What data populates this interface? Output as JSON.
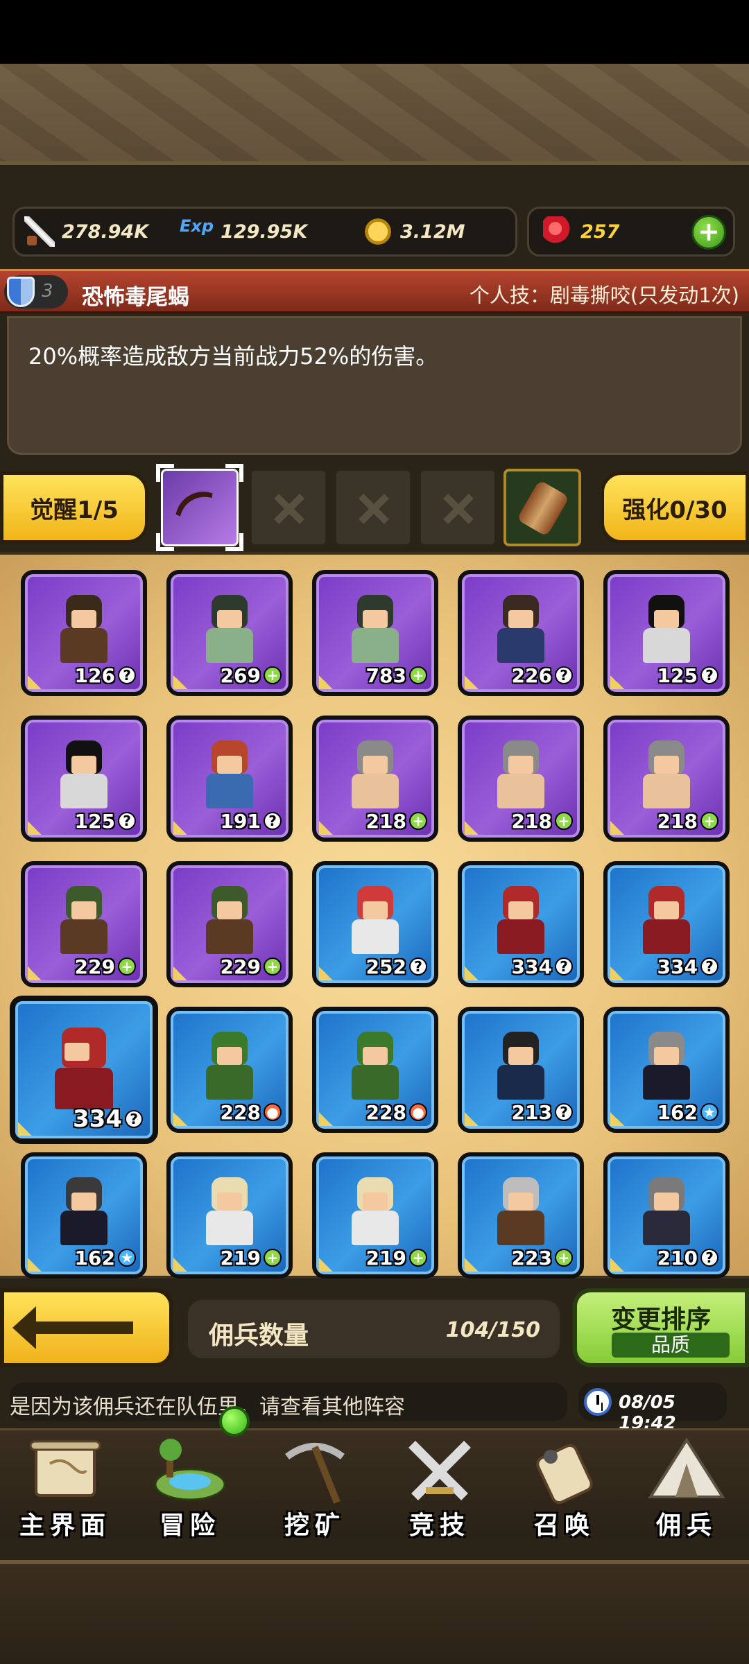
{
  "resources": {
    "attack": "278.94K",
    "exp_icon": "Exp",
    "exp": "129.95K",
    "gold": "3.12M",
    "gems": "257"
  },
  "skill": {
    "level": "3",
    "name": "恐怖毒尾蝎",
    "personal": "个人技：剧毒撕咬(只发动1次)",
    "description": "20%概率造成敌方当前战力52%的伤害。"
  },
  "awaken": {
    "label": "觉醒1/5"
  },
  "enhance": {
    "label": "强化0/30"
  },
  "heroes": [
    {
      "level": "126",
      "badge": "?",
      "rarity": "purple"
    },
    {
      "level": "269",
      "badge": "+",
      "rarity": "purple"
    },
    {
      "level": "783",
      "badge": "+",
      "rarity": "purple"
    },
    {
      "level": "226",
      "badge": "?",
      "rarity": "purple"
    },
    {
      "level": "125",
      "badge": "?",
      "rarity": "purple"
    },
    {
      "level": "125",
      "badge": "?",
      "rarity": "purple"
    },
    {
      "level": "191",
      "badge": "?",
      "rarity": "purple"
    },
    {
      "level": "218",
      "badge": "+",
      "rarity": "purple"
    },
    {
      "level": "218",
      "badge": "+",
      "rarity": "purple"
    },
    {
      "level": "218",
      "badge": "+",
      "rarity": "purple"
    },
    {
      "level": "229",
      "badge": "+",
      "rarity": "purple"
    },
    {
      "level": "229",
      "badge": "+",
      "rarity": "purple"
    },
    {
      "level": "252",
      "badge": "?",
      "rarity": "blue"
    },
    {
      "level": "334",
      "badge": "?",
      "rarity": "blue"
    },
    {
      "level": "334",
      "badge": "?",
      "rarity": "blue"
    },
    {
      "level": "334",
      "badge": "?",
      "rarity": "blue"
    },
    {
      "level": "228",
      "badge": "r",
      "rarity": "blue"
    },
    {
      "level": "228",
      "badge": "r",
      "rarity": "blue"
    },
    {
      "level": "213",
      "badge": "?",
      "rarity": "blue"
    },
    {
      "level": "162",
      "badge": "s",
      "rarity": "blue"
    },
    {
      "level": "162",
      "badge": "s",
      "rarity": "blue"
    },
    {
      "level": "219",
      "badge": "+",
      "rarity": "blue"
    },
    {
      "level": "219",
      "badge": "+",
      "rarity": "blue"
    },
    {
      "level": "223",
      "badge": "+",
      "rarity": "blue"
    },
    {
      "level": "210",
      "badge": "?",
      "rarity": "blue"
    }
  ],
  "mercenary_count": {
    "label": "佣兵数量",
    "value": "104/150"
  },
  "sort": {
    "title": "变更排序",
    "mode": "品质"
  },
  "message": "是因为该佣兵还在队伍里，请查看其他阵容",
  "time": "08/05 19:42",
  "nav": [
    {
      "label": "主界面",
      "icon": "map-scroll-icon"
    },
    {
      "label": "冒险",
      "icon": "island-icon"
    },
    {
      "label": "挖矿",
      "icon": "pickaxe-icon"
    },
    {
      "label": "竞技",
      "icon": "crossed-swords-icon"
    },
    {
      "label": "召唤",
      "icon": "summon-scroll-icon"
    },
    {
      "label": "佣兵",
      "icon": "tent-icon"
    }
  ],
  "colors": {
    "accent": "#f1b51a",
    "green": "#86cc37",
    "skill_bar": "#9b3824"
  }
}
